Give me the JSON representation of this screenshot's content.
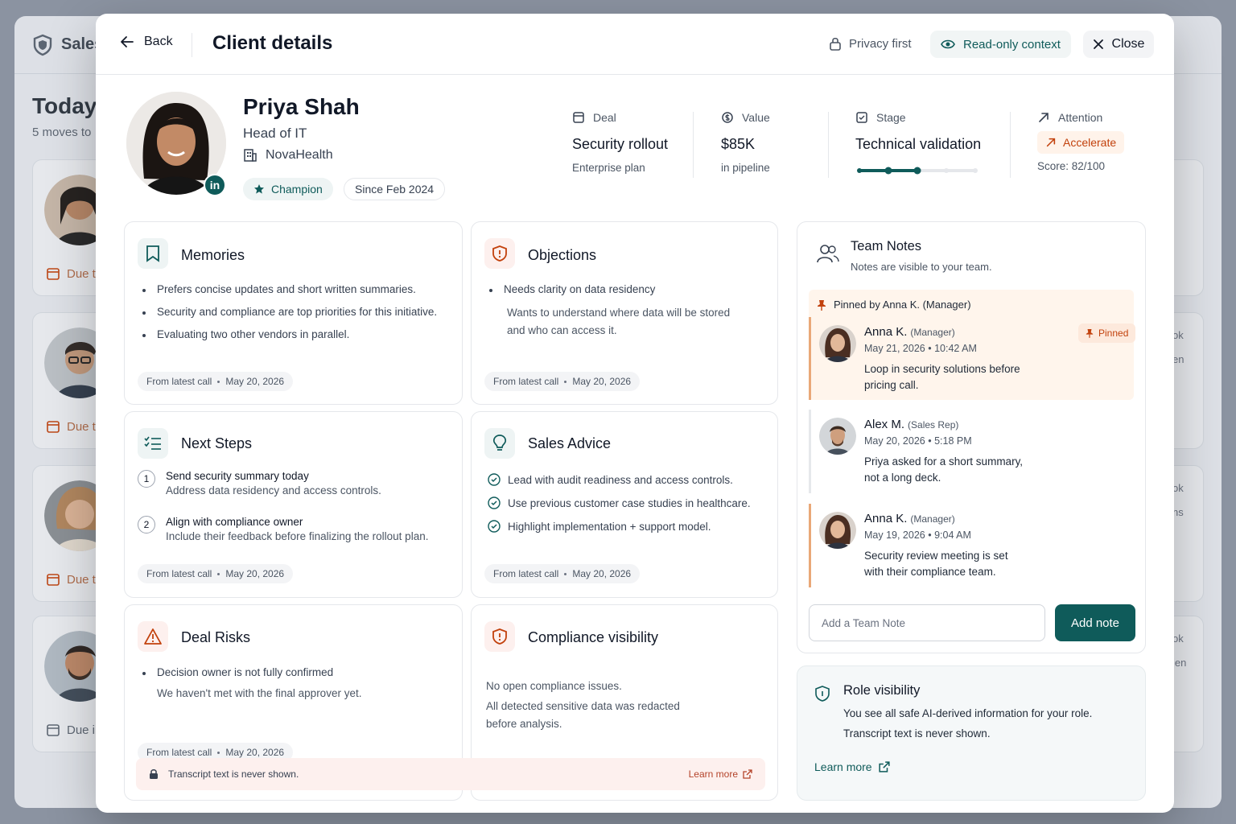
{
  "background": {
    "brand": "Sales",
    "heading": "Today",
    "subheading": "5 moves to",
    "due_labels": [
      "Due t",
      "Due t",
      "Due t",
      "Due in"
    ],
    "right_texts": [
      "ok",
      "en",
      "ok",
      "ns",
      "ok",
      "ien"
    ]
  },
  "header": {
    "back_label": "Back",
    "title": "Client details",
    "privacy_label": "Privacy first",
    "readonly_label": "Read-only context",
    "close_label": "Close"
  },
  "profile": {
    "name": "Priya Shah",
    "role": "Head of IT",
    "company": "NovaHealth",
    "badge": "Champion",
    "since": "Since Feb 2024",
    "linkedin": "in"
  },
  "metrics": {
    "deal": {
      "label": "Deal",
      "value": "Security rollout",
      "sub": "Enterprise plan"
    },
    "value": {
      "label": "Value",
      "value": "$85K",
      "sub": "in pipeline"
    },
    "stage": {
      "label": "Stage",
      "value": "Technical validation",
      "progress_steps": 5,
      "progress_current": 3
    },
    "attention": {
      "label": "Attention",
      "value": "Accelerate",
      "sub": "Score: 82/100"
    }
  },
  "memories": {
    "title": "Memories",
    "items": [
      "Prefers concise updates and short written summaries.",
      "Security and compliance are top priorities for this initiative.",
      "Evaluating two other vendors in parallel."
    ],
    "source": "From latest call",
    "date": "May 20, 2026"
  },
  "objections": {
    "title": "Objections",
    "heading": "Needs clarity on data residency",
    "text_line1": "Wants to understand where data will be stored",
    "text_line2": "and who can access it.",
    "source": "From latest call",
    "date": "May 20, 2026"
  },
  "next_steps": {
    "title": "Next Steps",
    "steps": [
      {
        "num": "1",
        "title": "Send security summary today",
        "desc": "Address data residency and access controls."
      },
      {
        "num": "2",
        "title": "Align with compliance owner",
        "desc": "Include their feedback before finalizing the rollout plan."
      }
    ],
    "source": "From latest call",
    "date": "May 20, 2026"
  },
  "sales_advice": {
    "title": "Sales Advice",
    "items": [
      "Lead with audit readiness and access controls.",
      "Use previous customer case studies in healthcare.",
      "Highlight implementation + support model."
    ],
    "source": "From latest call",
    "date": "May 20, 2026"
  },
  "deal_risks": {
    "title": "Deal Risks",
    "heading": "Decision owner is not fully confirmed",
    "text": "We haven't met with the final approver yet.",
    "source": "From latest call",
    "date": "May 20, 2026"
  },
  "compliance": {
    "title": "Compliance visibility",
    "line1": "No open compliance issues.",
    "line2a": "All detected sensitive data was redacted",
    "line2b": "before analysis."
  },
  "banner": {
    "text": "Transcript text is never shown.",
    "link": "Learn more"
  },
  "team_notes": {
    "title": "Team Notes",
    "subtitle": "Notes are visible to your team.",
    "pinned_by": "Pinned by Anna K. (Manager)",
    "pinned_badge": "Pinned",
    "notes": [
      {
        "name": "Anna K.",
        "role": "(Manager)",
        "date": "May 21, 2026 • 10:42 AM",
        "line1": "Loop in security solutions before",
        "line2": "pricing call."
      },
      {
        "name": "Alex M.",
        "role": "(Sales Rep)",
        "date": "May 20, 2026 • 5:18 PM",
        "line1": "Priya asked for a short summary,",
        "line2": "not a long deck."
      },
      {
        "name": "Anna K.",
        "role": "(Manager)",
        "date": "May 19, 2026 • 9:04 AM",
        "line1": "Security review meeting is set",
        "line2": "with their compliance team."
      }
    ],
    "input_placeholder": "Add a Team Note",
    "add_button": "Add note"
  },
  "role_visibility": {
    "title": "Role visibility",
    "line1": "You see all safe AI-derived information for your role.",
    "line2": "Transcript text is never shown.",
    "link": "Learn more"
  },
  "colors": {
    "primary": "#0f5b5a",
    "accent_orange": "#c2410c",
    "risk_red": "#b4432a"
  }
}
